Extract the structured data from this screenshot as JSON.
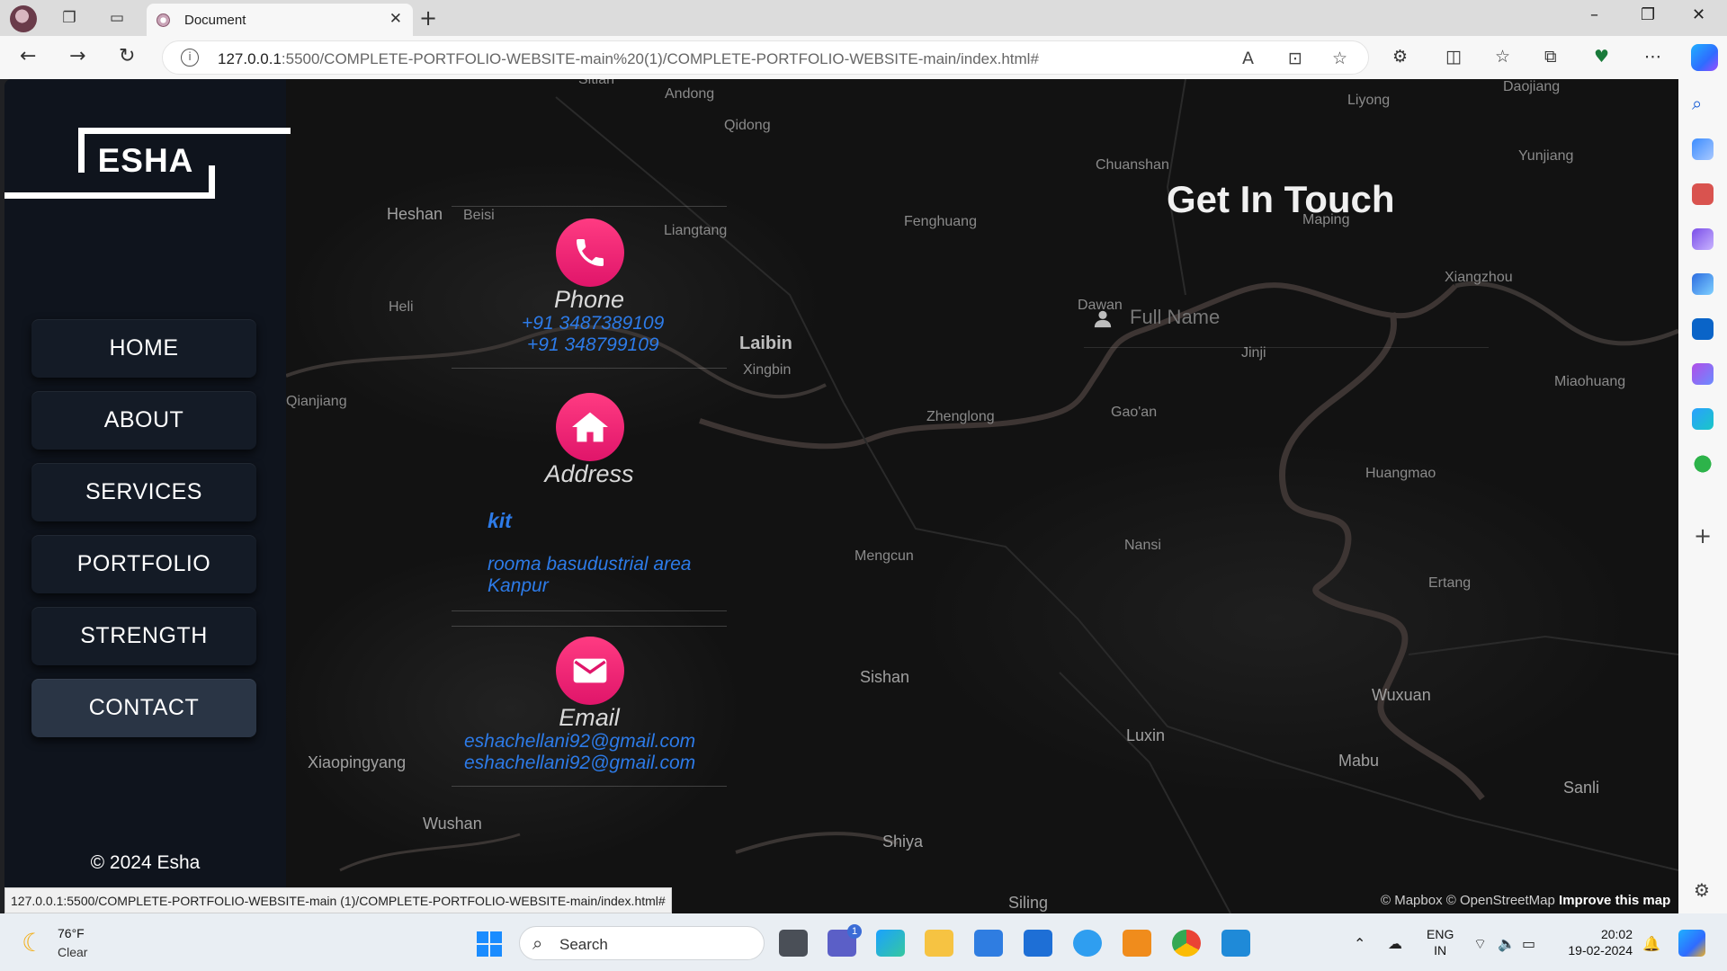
{
  "browser": {
    "tab_title": "Document",
    "url_host": "127.0.0.1",
    "url_rest": ":5500/COMPLETE-PORTFOLIO-WEBSITE-main%20(1)/COMPLETE-PORTFOLIO-WEBSITE-main/index.html#",
    "status_url": "127.0.0.1:5500/COMPLETE-PORTFOLIO-WEBSITE-main (1)/COMPLETE-PORTFOLIO-WEBSITE-main/index.html#"
  },
  "site": {
    "logo": "ESHA",
    "nav": [
      {
        "label": "HOME"
      },
      {
        "label": "ABOUT"
      },
      {
        "label": "SERVICES"
      },
      {
        "label": "PORTFOLIO"
      },
      {
        "label": "STRENGTH"
      },
      {
        "label": "CONTACT"
      }
    ],
    "copyright": "© 2024 Esha"
  },
  "contact": {
    "phone": {
      "title": "Phone",
      "line1": "+91 3487389109",
      "line2": "+91 348799109"
    },
    "address": {
      "title": "Address",
      "name": "kit",
      "line1": "rooma basudustrial area",
      "line2": "Kanpur"
    },
    "email": {
      "title": "Email",
      "line1": "eshachellani92@gmail.com",
      "line2": "eshachellani92@gmail.com"
    },
    "heading": "Get In Touch",
    "full_name_placeholder": "Full Name"
  },
  "map": {
    "attribution": "© Mapbox © OpenStreetMap",
    "improve": "Improve this map",
    "places": [
      "Sitian",
      "Andong",
      "Qidong",
      "Heshan",
      "Beisi",
      "Liangtang",
      "Heli",
      "Laibin",
      "Xingbin",
      "Qianjiang",
      "Zhenglong",
      "Gao'an",
      "Dawan",
      "Jinji",
      "Fenghuang",
      "Chuanshan",
      "Liyong",
      "Daojiang",
      "Yunjiang",
      "Xiangzhou",
      "Maping",
      "Miaohuang",
      "Huangmao",
      "Mengcun",
      "Nansi",
      "Ertang",
      "Sishan",
      "Luxin",
      "Wuxuan",
      "Mabu",
      "Sanli",
      "Xiaopingyang",
      "Wushan",
      "Shiya",
      "Siling"
    ]
  },
  "taskbar": {
    "temp": "76°F",
    "condition": "Clear",
    "search": "Search",
    "lang1": "ENG",
    "lang2": "IN",
    "time": "20:02",
    "date": "19-02-2024",
    "notif_count": "1"
  },
  "colors": {
    "accent_pink": "#e91e75",
    "link_blue": "#2d7be8",
    "sidebar_bg": "#0f141d"
  }
}
